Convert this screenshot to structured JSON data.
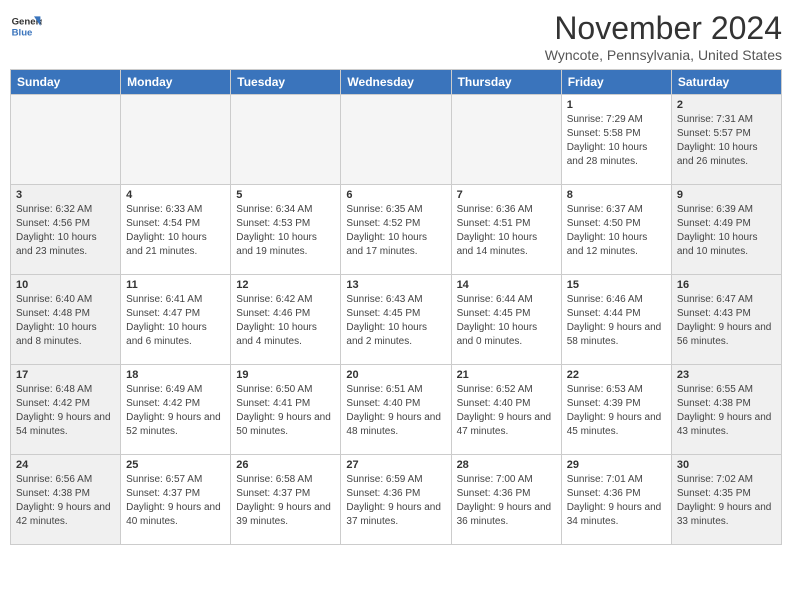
{
  "header": {
    "logo_line1": "General",
    "logo_line2": "Blue",
    "month": "November 2024",
    "location": "Wyncote, Pennsylvania, United States"
  },
  "weekdays": [
    "Sunday",
    "Monday",
    "Tuesday",
    "Wednesday",
    "Thursday",
    "Friday",
    "Saturday"
  ],
  "weeks": [
    [
      {
        "day": "",
        "empty": true
      },
      {
        "day": "",
        "empty": true
      },
      {
        "day": "",
        "empty": true
      },
      {
        "day": "",
        "empty": true
      },
      {
        "day": "",
        "empty": true
      },
      {
        "day": "1",
        "sunrise": "7:29 AM",
        "sunset": "5:58 PM",
        "daylight": "10 hours and 28 minutes."
      },
      {
        "day": "2",
        "sunrise": "7:31 AM",
        "sunset": "5:57 PM",
        "daylight": "10 hours and 26 minutes."
      }
    ],
    [
      {
        "day": "3",
        "sunrise": "6:32 AM",
        "sunset": "4:56 PM",
        "daylight": "10 hours and 23 minutes."
      },
      {
        "day": "4",
        "sunrise": "6:33 AM",
        "sunset": "4:54 PM",
        "daylight": "10 hours and 21 minutes."
      },
      {
        "day": "5",
        "sunrise": "6:34 AM",
        "sunset": "4:53 PM",
        "daylight": "10 hours and 19 minutes."
      },
      {
        "day": "6",
        "sunrise": "6:35 AM",
        "sunset": "4:52 PM",
        "daylight": "10 hours and 17 minutes."
      },
      {
        "day": "7",
        "sunrise": "6:36 AM",
        "sunset": "4:51 PM",
        "daylight": "10 hours and 14 minutes."
      },
      {
        "day": "8",
        "sunrise": "6:37 AM",
        "sunset": "4:50 PM",
        "daylight": "10 hours and 12 minutes."
      },
      {
        "day": "9",
        "sunrise": "6:39 AM",
        "sunset": "4:49 PM",
        "daylight": "10 hours and 10 minutes."
      }
    ],
    [
      {
        "day": "10",
        "sunrise": "6:40 AM",
        "sunset": "4:48 PM",
        "daylight": "10 hours and 8 minutes."
      },
      {
        "day": "11",
        "sunrise": "6:41 AM",
        "sunset": "4:47 PM",
        "daylight": "10 hours and 6 minutes."
      },
      {
        "day": "12",
        "sunrise": "6:42 AM",
        "sunset": "4:46 PM",
        "daylight": "10 hours and 4 minutes."
      },
      {
        "day": "13",
        "sunrise": "6:43 AM",
        "sunset": "4:45 PM",
        "daylight": "10 hours and 2 minutes."
      },
      {
        "day": "14",
        "sunrise": "6:44 AM",
        "sunset": "4:45 PM",
        "daylight": "10 hours and 0 minutes."
      },
      {
        "day": "15",
        "sunrise": "6:46 AM",
        "sunset": "4:44 PM",
        "daylight": "9 hours and 58 minutes."
      },
      {
        "day": "16",
        "sunrise": "6:47 AM",
        "sunset": "4:43 PM",
        "daylight": "9 hours and 56 minutes."
      }
    ],
    [
      {
        "day": "17",
        "sunrise": "6:48 AM",
        "sunset": "4:42 PM",
        "daylight": "9 hours and 54 minutes."
      },
      {
        "day": "18",
        "sunrise": "6:49 AM",
        "sunset": "4:42 PM",
        "daylight": "9 hours and 52 minutes."
      },
      {
        "day": "19",
        "sunrise": "6:50 AM",
        "sunset": "4:41 PM",
        "daylight": "9 hours and 50 minutes."
      },
      {
        "day": "20",
        "sunrise": "6:51 AM",
        "sunset": "4:40 PM",
        "daylight": "9 hours and 48 minutes."
      },
      {
        "day": "21",
        "sunrise": "6:52 AM",
        "sunset": "4:40 PM",
        "daylight": "9 hours and 47 minutes."
      },
      {
        "day": "22",
        "sunrise": "6:53 AM",
        "sunset": "4:39 PM",
        "daylight": "9 hours and 45 minutes."
      },
      {
        "day": "23",
        "sunrise": "6:55 AM",
        "sunset": "4:38 PM",
        "daylight": "9 hours and 43 minutes."
      }
    ],
    [
      {
        "day": "24",
        "sunrise": "6:56 AM",
        "sunset": "4:38 PM",
        "daylight": "9 hours and 42 minutes."
      },
      {
        "day": "25",
        "sunrise": "6:57 AM",
        "sunset": "4:37 PM",
        "daylight": "9 hours and 40 minutes."
      },
      {
        "day": "26",
        "sunrise": "6:58 AM",
        "sunset": "4:37 PM",
        "daylight": "9 hours and 39 minutes."
      },
      {
        "day": "27",
        "sunrise": "6:59 AM",
        "sunset": "4:36 PM",
        "daylight": "9 hours and 37 minutes."
      },
      {
        "day": "28",
        "sunrise": "7:00 AM",
        "sunset": "4:36 PM",
        "daylight": "9 hours and 36 minutes."
      },
      {
        "day": "29",
        "sunrise": "7:01 AM",
        "sunset": "4:36 PM",
        "daylight": "9 hours and 34 minutes."
      },
      {
        "day": "30",
        "sunrise": "7:02 AM",
        "sunset": "4:35 PM",
        "daylight": "9 hours and 33 minutes."
      }
    ]
  ]
}
